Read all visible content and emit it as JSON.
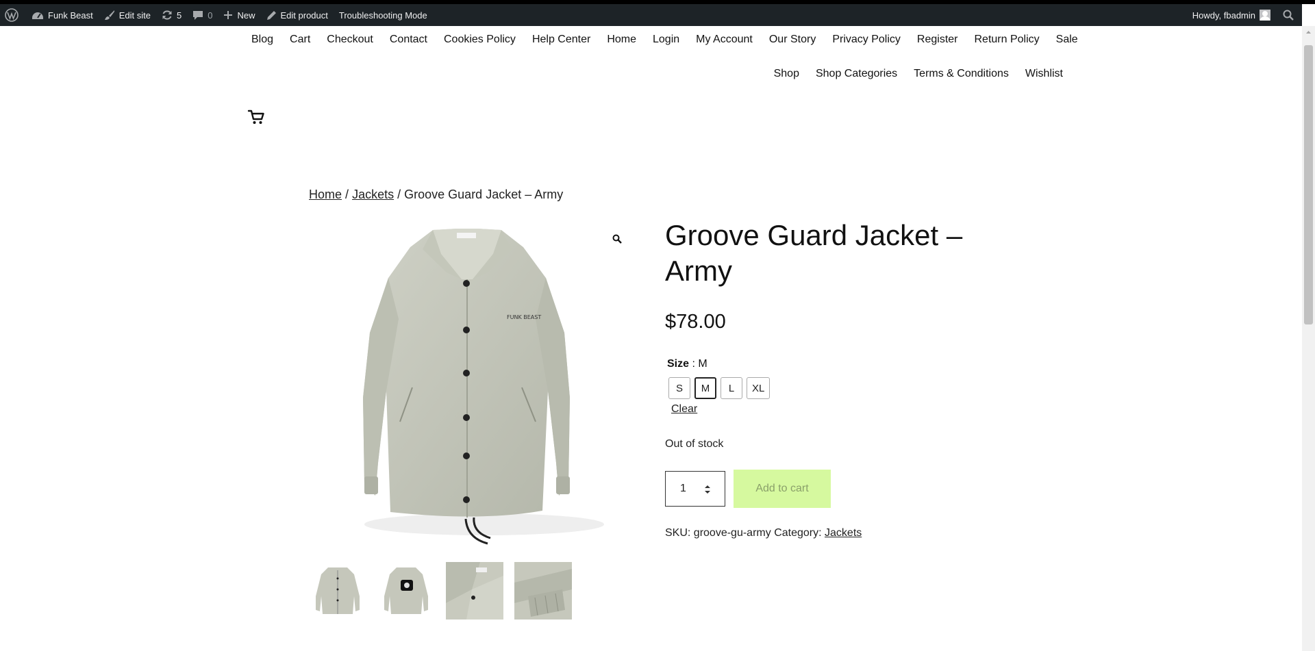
{
  "adminbar": {
    "site_name": "Funk Beast",
    "edit_site": "Edit site",
    "updates_count": "5",
    "comments_count": "0",
    "new_label": "New",
    "edit_product": "Edit product",
    "troubleshooting": "Troubleshooting Mode",
    "howdy": "Howdy, fbadmin"
  },
  "nav": {
    "row1": [
      "Blog",
      "Cart",
      "Checkout",
      "Contact",
      "Cookies Policy",
      "Help Center",
      "Home",
      "Login",
      "My Account",
      "Our Story",
      "Privacy Policy",
      "Register",
      "Return Policy",
      "Sale"
    ],
    "row2": [
      "Shop",
      "Shop Categories",
      "Terms & Conditions",
      "Wishlist"
    ]
  },
  "breadcrumb": {
    "home": "Home",
    "sep": "/",
    "category": "Jackets",
    "current": "Groove Guard Jacket – Army"
  },
  "product": {
    "title": "Groove Guard Jacket – Army",
    "price": "$78.00",
    "size_label": "Size",
    "size_sep": " : ",
    "size_value": "M",
    "sizes": [
      "S",
      "M",
      "L",
      "XL"
    ],
    "selected_size": "M",
    "clear": "Clear",
    "stock": "Out of stock",
    "quantity": "1",
    "add_to_cart": "Add to cart",
    "sku_label": "SKU:",
    "sku": "groove-gu-army",
    "category_label": "Category:",
    "category": "Jackets",
    "logo_text": "FUNK BEAST"
  },
  "colors": {
    "adminbar_bg": "#1d2327",
    "add_to_cart_bg": "#d6f99f",
    "jacket": "#c7c9bd"
  }
}
